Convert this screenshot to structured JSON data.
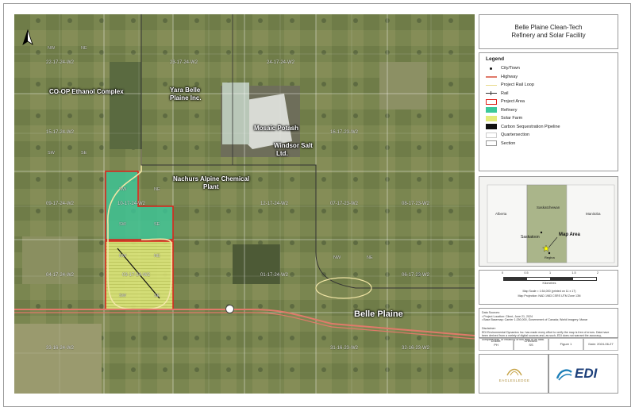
{
  "title": {
    "line1": "Belle Plaine Clean-Tech",
    "line2": "Refinery and Solar Facility"
  },
  "map_labels": {
    "coop": "CO-OP Ethanol Complex",
    "yara_1": "Yara Belle",
    "yara_2": "Plaine Inc.",
    "mosaic": "Mosaic Potash",
    "windsor_1": "Windsor Salt",
    "windsor_2": "Ltd.",
    "nachurs_1": "Nachurs Alpine Chemical",
    "nachurs_2": "Plant",
    "belle_plaine": "Belle Plaine"
  },
  "sections": [
    "22-17-24-W2",
    "23-17-24-W2",
    "24-17-24-W2",
    "15-17-24-W2",
    "16-17-23-W2",
    "10-17-24-W2",
    "09-17-24-W2",
    "12-17-24-W2",
    "07-17-23-W2",
    "08-17-23-W2",
    "04-17-24-W2",
    "03-17-24-W2",
    "01-17-24-W2",
    "06-17-23-W2",
    "33-16-24-W2",
    "31-16-23-W2",
    "32-16-23-W2"
  ],
  "quarters": [
    "NW",
    "NE",
    "SW",
    "SE"
  ],
  "legend": {
    "heading": "Legend",
    "items": [
      {
        "label": "City/Town",
        "symbol": "dot"
      },
      {
        "label": "Highway",
        "symbol": "highway"
      },
      {
        "label": "Project Rail Loop",
        "symbol": "rail-loop"
      },
      {
        "label": "Rail",
        "symbol": "rail"
      },
      {
        "label": "Project Area",
        "symbol": "project-area"
      },
      {
        "label": "Refinery",
        "symbol": "refinery"
      },
      {
        "label": "Solar Farm",
        "symbol": "solar"
      },
      {
        "label": "Carbon Sequestration Pipeline",
        "symbol": "pipeline"
      },
      {
        "label": "Quartersection",
        "symbol": "quarter"
      },
      {
        "label": "Section",
        "symbol": "section"
      }
    ]
  },
  "colors": {
    "highway": "#e07a6a",
    "rail_loop": "#f2e6a6",
    "rail": "#333333",
    "project_area": "#e0201a",
    "refinery": "#3cc89a",
    "solar": "#e4ec7a",
    "pipeline": "#111111"
  },
  "inset": {
    "labels": {
      "alberta": "Alberta",
      "saskatchewan": "Saskatchewan",
      "manitoba": "Manitoba",
      "saskatoon": "Saskatoon",
      "regina": "Regina",
      "map_area": "Map Area"
    }
  },
  "scale": {
    "ticks": [
      "0",
      "0.5",
      "1",
      "1.5",
      "2"
    ],
    "unit": "Kilometres",
    "note1": "Map Scale = 1:54,000 (printed on 11 x 17)",
    "note2": "Map Projection: NAD 1983 CSRS UTM Zone 13N"
  },
  "sources": {
    "heading": "Data Sources:",
    "line1": "• Project Location: Client, June 21, 2024",
    "line2": "• Base Basemap: Carrier 1:250,000, Government of Canada; World Imagery: Maxar"
  },
  "disclaimer": {
    "heading": "Disclaimer:",
    "text": "EDI Environmental Dynamics Inc. has made every effort to verify the map is free of errors. Data have been derived from a variety of digital sources and, as such, EDI does not warrant the accuracy, completeness, or reliability of this map or its data."
  },
  "title_block": {
    "drawn_label": "Drawn:",
    "drawn": "PH",
    "checked_label": "Checked:",
    "checked": "SS",
    "figure": "Figure 1",
    "date_label": "Date:",
    "date": "2024-06-27"
  },
  "logos": {
    "client": "EAGLESLEDGE",
    "edi": "EDI"
  }
}
